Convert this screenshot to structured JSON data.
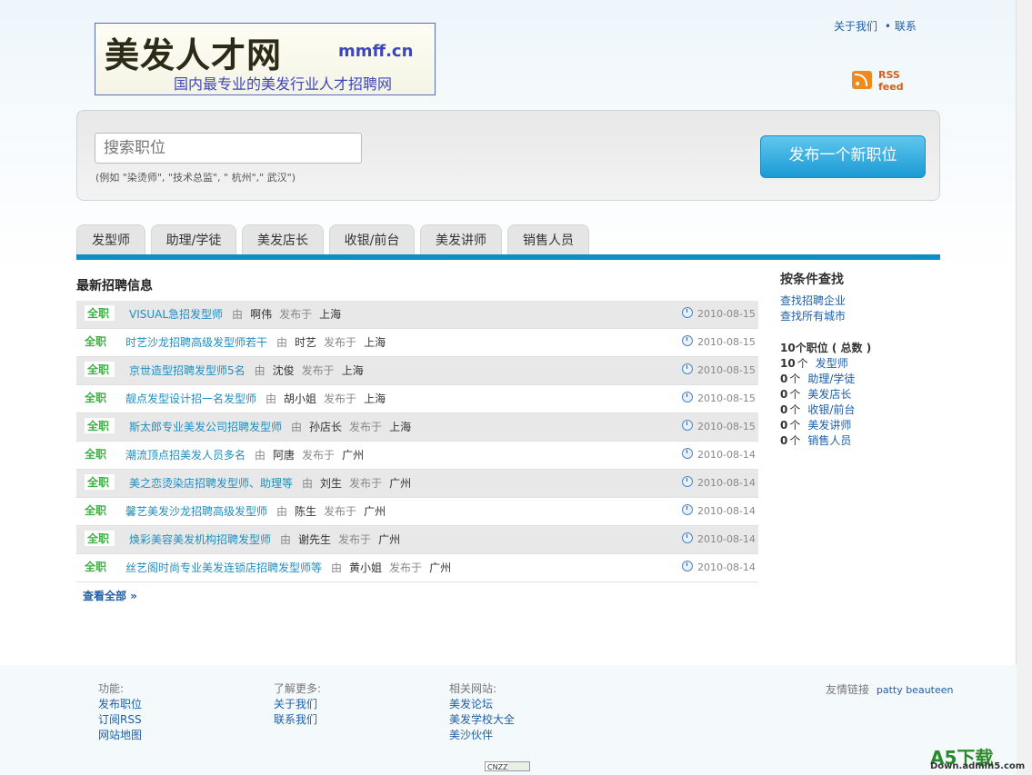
{
  "header": {
    "logo_main": "美发人才网",
    "logo_domain": "mmff.cn",
    "logo_sub": "国内最专业的美发行业人才招聘网",
    "links": [
      "关于我们",
      "联系"
    ],
    "rss_label": "RSS feed"
  },
  "search": {
    "placeholder": "搜索职位",
    "hint": "(例如 \"染烫师\", \"技术总监\", \" 杭州\",\" 武汉\")",
    "post_button": "发布一个新职位"
  },
  "tabs": [
    "发型师",
    "助理/学徒",
    "美发店长",
    "收银/前台",
    "美发讲师",
    "销售人员"
  ],
  "main": {
    "section_title": "最新招聘信息",
    "by_label": "由",
    "posted_label": "发布于",
    "jobs": [
      {
        "type": "全职",
        "title": "VISUAL急招发型师",
        "poster": "啊伟",
        "city": "上海",
        "date": "2010-08-15"
      },
      {
        "type": "全职",
        "title": "时艺沙龙招聘高级发型师若干",
        "poster": "时艺",
        "city": "上海",
        "date": "2010-08-15"
      },
      {
        "type": "全职",
        "title": "京世造型招聘发型师5名",
        "poster": "沈俊",
        "city": "上海",
        "date": "2010-08-15"
      },
      {
        "type": "全职",
        "title": "靓点发型设计招一名发型师",
        "poster": "胡小姐",
        "city": "上海",
        "date": "2010-08-15"
      },
      {
        "type": "全职",
        "title": "斯太郎专业美发公司招聘发型师",
        "poster": "孙店长",
        "city": "上海",
        "date": "2010-08-15"
      },
      {
        "type": "全职",
        "title": "潮流顶点招美发人员多名",
        "poster": "阿唐",
        "city": "广州",
        "date": "2010-08-14"
      },
      {
        "type": "全职",
        "title": "美之恋烫染店招聘发型师、助理等",
        "poster": "刘生",
        "city": "广州",
        "date": "2010-08-14"
      },
      {
        "type": "全职",
        "title": "馨艺美发沙龙招聘高级发型师",
        "poster": "陈生",
        "city": "广州",
        "date": "2010-08-14"
      },
      {
        "type": "全职",
        "title": "焕彩美容美发机构招聘发型师",
        "poster": "谢先生",
        "city": "广州",
        "date": "2010-08-14"
      },
      {
        "type": "全职",
        "title": "丝艺阁时尚专业美发连锁店招聘发型师等",
        "poster": "黄小姐",
        "city": "广州",
        "date": "2010-08-14"
      }
    ],
    "view_all": "查看全部 »"
  },
  "sidebar": {
    "title": "按条件查找",
    "links": [
      "查找招聘企业",
      "查找所有城市"
    ],
    "total_count": "10",
    "total_label": "个职位 ( 总数 )",
    "unit": "个",
    "categories": [
      {
        "count": "10",
        "name": "发型师"
      },
      {
        "count": "0",
        "name": "助理/学徒"
      },
      {
        "count": "0",
        "name": "美发店长"
      },
      {
        "count": "0",
        "name": "收银/前台"
      },
      {
        "count": "0",
        "name": "美发讲师"
      },
      {
        "count": "0",
        "name": "销售人员"
      }
    ]
  },
  "footer": {
    "col1": {
      "head": "功能:",
      "links": [
        "发布职位",
        "订阅RSS",
        "网站地图"
      ]
    },
    "col2": {
      "head": "了解更多:",
      "links": [
        "关于我们",
        "联系我们"
      ]
    },
    "col3": {
      "head": "相关网站:",
      "links": [
        "美发论坛",
        "美发学校大全",
        "美沙伙伴"
      ]
    },
    "friend_label": "友情链接",
    "friend_link": "patty beauteen",
    "cnzz": "CNZZ",
    "watermark": "A5下载",
    "watermark_sub": "Down.admin5.com"
  },
  "colors": {
    "accent": "#0f8ec5",
    "link": "#1f5fa6",
    "badge": "#3cb043"
  },
  "icons": [
    "rss-icon",
    "clock-icon"
  ]
}
